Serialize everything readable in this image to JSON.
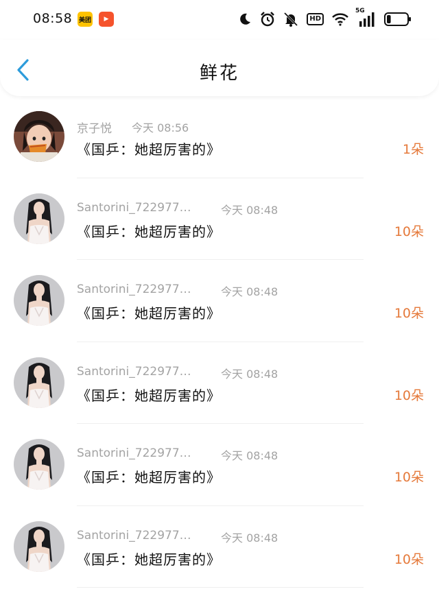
{
  "status_bar": {
    "time": "08:58",
    "meituan_label": "美团",
    "video_label": "▶",
    "hd_label": "HD",
    "network_label": "5G",
    "icons": [
      "moon-icon",
      "alarm-icon",
      "mute-icon",
      "hd-icon",
      "wifi-icon",
      "signal-icon",
      "battery-icon"
    ],
    "battery_level": 0.2
  },
  "nav": {
    "title": "鲜花",
    "back_icon": "chevron-left-icon",
    "accent_color": "#2d9cdb"
  },
  "gifts": [
    {
      "user": "京子悦",
      "time": "今天 08:56",
      "message": "《国乒：她超厉害的》",
      "count": "1朵",
      "avatar": "child"
    },
    {
      "user": "Santorini_722977…",
      "time": "今天 08:48",
      "message": "《国乒：她超厉害的》",
      "count": "10朵",
      "avatar": "woman"
    },
    {
      "user": "Santorini_722977…",
      "time": "今天 08:48",
      "message": "《国乒：她超厉害的》",
      "count": "10朵",
      "avatar": "woman"
    },
    {
      "user": "Santorini_722977…",
      "time": "今天 08:48",
      "message": "《国乒：她超厉害的》",
      "count": "10朵",
      "avatar": "woman"
    },
    {
      "user": "Santorini_722977…",
      "time": "今天 08:48",
      "message": "《国乒：她超厉害的》",
      "count": "10朵",
      "avatar": "woman"
    },
    {
      "user": "Santorini_722977…",
      "time": "今天 08:48",
      "message": "《国乒：她超厉害的》",
      "count": "10朵",
      "avatar": "woman"
    }
  ],
  "colors": {
    "count_text": "#e5793a",
    "meta_text": "#a3a3a3"
  }
}
